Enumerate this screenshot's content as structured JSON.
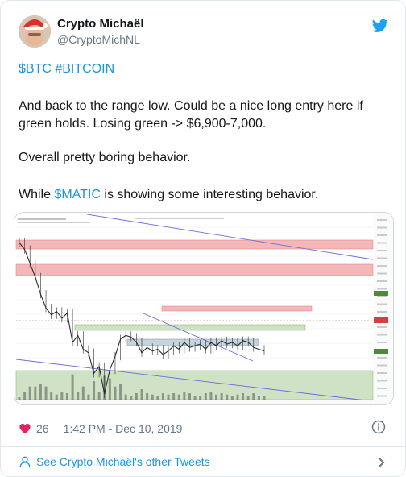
{
  "tweet": {
    "author_name": "Crypto Michaël",
    "author_handle": "@CryptoMichNL",
    "paragraphs": {
      "p1": "$BTC #BITCOIN",
      "p2": "And back to the range low. Could be a nice long entry here if green holds. Losing green -> $6,900-7,000.",
      "p3": "Overall pretty boring behavior.",
      "p4_prefix": "While ",
      "p4_link": "$MATIC",
      "p4_suffix": " is showing some interesting behavior."
    },
    "like_count": "26",
    "timestamp": "1:42 PM - Dec 10, 2019",
    "footer_link": "See Crypto Michaël's other Tweets",
    "icons": [
      "twitter-bird-icon",
      "heart-icon",
      "info-icon",
      "person-icon",
      "chevron-right-icon"
    ]
  },
  "colors": {
    "link": "#1b95e0",
    "brand": "#1da1f2",
    "heart": "#e0245e",
    "red_zone": "#f4b6b6",
    "green_zone": "#cfe2c5",
    "grey_zone": "#c6d4dd"
  },
  "chart_data": {
    "type": "line",
    "title": "",
    "x": [
      0,
      1,
      2,
      3,
      4,
      5,
      6,
      7,
      8,
      9,
      10,
      11,
      12,
      13,
      14,
      15,
      16,
      17,
      18,
      19,
      20,
      21,
      22,
      23,
      24,
      25,
      26,
      27,
      28,
      29,
      30,
      31,
      32,
      33,
      34,
      35,
      36,
      37,
      38,
      39,
      40,
      41,
      42,
      43,
      44,
      45,
      46
    ],
    "values": [
      10400,
      10200,
      9800,
      9400,
      8900,
      8500,
      8300,
      8400,
      8200,
      8350,
      7500,
      7700,
      7300,
      7200,
      6600,
      6800,
      6000,
      6700,
      7100,
      7600,
      7700,
      7650,
      7500,
      7200,
      7350,
      7250,
      7300,
      7150,
      7250,
      7400,
      7300,
      7500,
      7350,
      7400,
      7450,
      7300,
      7500,
      7400,
      7550,
      7450,
      7500,
      7400,
      7550,
      7500,
      7350,
      7300,
      7250
    ],
    "ylim": [
      6000,
      10800
    ]
  }
}
